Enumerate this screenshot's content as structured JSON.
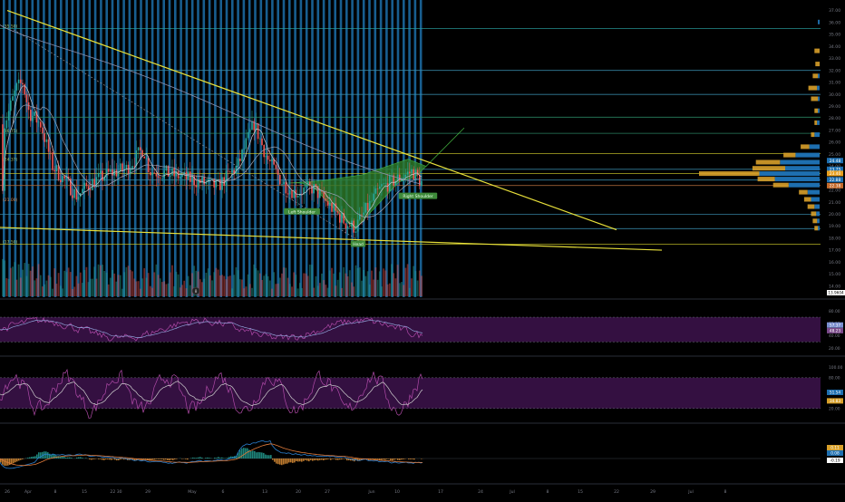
{
  "chart_data": {
    "type": "candlestick",
    "price_axis": {
      "ticks": [
        "37.00",
        "36.00",
        "35.00",
        "34.00",
        "33.00",
        "32.00",
        "31.00",
        "30.00",
        "29.00",
        "28.00",
        "27.00",
        "26.00",
        "25.00",
        "24.00",
        "23.00",
        "22.00",
        "21.00",
        "20.00",
        "19.00",
        "18.00",
        "17.00",
        "16.00",
        "15.00",
        "14.00"
      ],
      "range": [
        13.3,
        37.5
      ],
      "last_price": "23.38",
      "badges": [
        {
          "label": "24.48",
          "value": 24.48,
          "color": "#1e6fb0"
        },
        {
          "label": "23.75",
          "value": 23.75,
          "color": "#1e6fb0"
        },
        {
          "label": "23.40",
          "value": 23.4,
          "color": "#e8a020"
        },
        {
          "label": "22.88",
          "value": 22.88,
          "color": "#1e6fb0"
        },
        {
          "label": "22.38",
          "value": 22.38,
          "color": "#c46a2c"
        }
      ],
      "bottom_badge": "13.9604"
    },
    "levels": [
      {
        "label": "(35.50)",
        "value": 35.5
      },
      {
        "label": "(26.75)",
        "value": 26.75
      },
      {
        "label": "(24.37)",
        "value": 24.37
      },
      {
        "label": "(21.00)",
        "value": 21.0
      },
      {
        "label": "(17.50)",
        "value": 17.5
      }
    ],
    "pattern_labels": [
      "Left Shoulder",
      "Head",
      "Right Shoulder"
    ],
    "marker": "8",
    "rsi": {
      "ticks": [
        "80.00",
        "60.00",
        "40.00",
        "20.00"
      ],
      "badges": [
        "57.37",
        "48.23"
      ],
      "upper": 70,
      "lower": 30,
      "range": [
        10,
        95
      ]
    },
    "stoch": {
      "ticks": [
        "100.00",
        "80.00",
        "20.00"
      ],
      "badges": [
        "51.54",
        "34.83"
      ],
      "upper": 80,
      "lower": 20,
      "range": [
        -5,
        115
      ]
    },
    "macd": {
      "badges": [
        "0.11",
        "0.08",
        "-0.19"
      ]
    },
    "x_labels": [
      "26",
      "Apr",
      "8",
      "15",
      "22 30",
      "29",
      "May",
      "6",
      "13",
      "20",
      "27",
      "Jun",
      "10",
      "17",
      "24",
      "Jul",
      "8",
      "15",
      "22",
      "29",
      "Jul",
      "8"
    ],
    "colors": {
      "up": "#26a69a",
      "down": "#ef5350",
      "trendline": "#e8e03a",
      "ma": "#9aa0b4",
      "pattern_fill": "#2f7d2a",
      "vbar": "#1c6fa8",
      "rsi_band": "#3a1248",
      "stoch_band": "#3a1248"
    }
  }
}
